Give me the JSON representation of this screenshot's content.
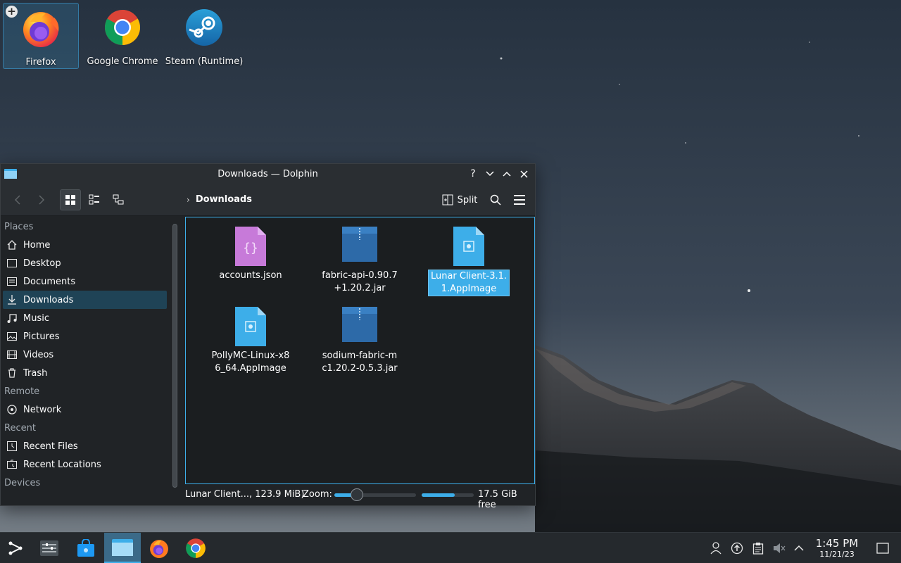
{
  "desktop": {
    "icons": [
      {
        "label": "Firefox",
        "icon": "firefox-icon",
        "selected": true
      },
      {
        "label": "Google Chrome",
        "icon": "chrome-icon"
      },
      {
        "label": "Steam (Runtime)",
        "icon": "steam-icon"
      }
    ]
  },
  "window": {
    "title": "Downloads — Dolphin",
    "controls": {
      "help": "?",
      "minimize": "minimize",
      "maximize": "maximize",
      "close": "close"
    },
    "toolbar": {
      "breadcrumb": "Downloads",
      "split_label": "Split"
    },
    "sidebar": {
      "sections": [
        {
          "title": "Places",
          "items": [
            {
              "label": "Home",
              "icon": "home-icon"
            },
            {
              "label": "Desktop",
              "icon": "desktop-icon"
            },
            {
              "label": "Documents",
              "icon": "documents-icon"
            },
            {
              "label": "Downloads",
              "icon": "downloads-icon",
              "active": true
            },
            {
              "label": "Music",
              "icon": "music-icon"
            },
            {
              "label": "Pictures",
              "icon": "pictures-icon"
            },
            {
              "label": "Videos",
              "icon": "videos-icon"
            },
            {
              "label": "Trash",
              "icon": "trash-icon"
            }
          ]
        },
        {
          "title": "Remote",
          "items": [
            {
              "label": "Network",
              "icon": "network-icon"
            }
          ]
        },
        {
          "title": "Recent",
          "items": [
            {
              "label": "Recent Files",
              "icon": "recent-files-icon"
            },
            {
              "label": "Recent Locations",
              "icon": "recent-locations-icon"
            }
          ]
        },
        {
          "title": "Devices",
          "items": []
        }
      ]
    },
    "files": [
      {
        "name": "accounts.json",
        "type": "json"
      },
      {
        "name": "fabric-api-0.90.7+1.20.2.jar",
        "type": "jar"
      },
      {
        "name": "Lunar Client-3.1.1.AppImage",
        "type": "appimage",
        "selected": true
      },
      {
        "name": "PollyMC-Linux-x86_64.AppImage",
        "type": "appimage"
      },
      {
        "name": "sodium-fabric-mc1.20.2-0.5.3.jar",
        "type": "jar"
      }
    ],
    "status": {
      "selection": "Lunar Client..., 123.9 MiB)",
      "zoom_label": "Zoom:",
      "zoom_level": 0.28,
      "used_space_fraction": 0.63,
      "free_space": "17.5 GiB free"
    }
  },
  "taskbar": {
    "apps": [
      "application-launcher-icon",
      "task-manager-icon",
      "discover-store-icon",
      "dolphin-icon",
      "firefox-icon",
      "chrome-icon"
    ],
    "tray": [
      "user-icon",
      "updates-icon",
      "clipboard-icon",
      "volume-muted-icon",
      "expand-tray-icon"
    ],
    "time": "1:45 PM",
    "date": "11/21/23"
  },
  "colors": {
    "accent": "#3daee9",
    "window_bg": "#202326",
    "view_bg": "#1b1e20",
    "panel_bg": "#25292d"
  }
}
